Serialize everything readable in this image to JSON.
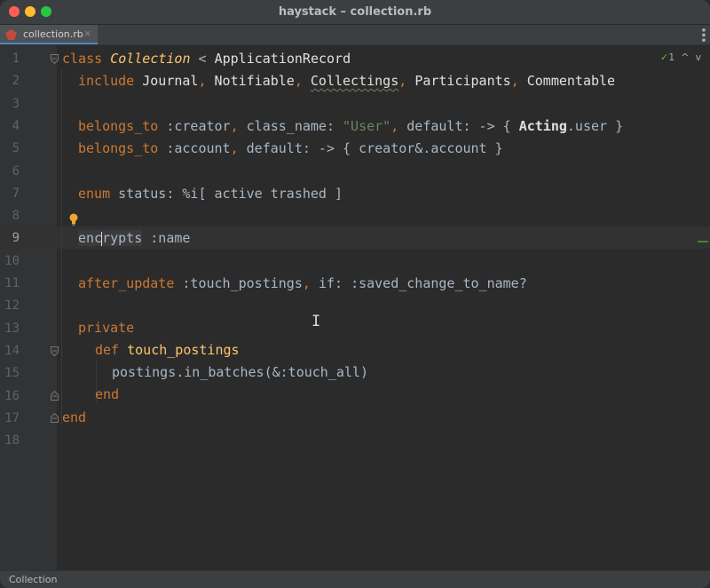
{
  "window": {
    "title": "haystack – collection.rb"
  },
  "tab": {
    "label": "collection.rb",
    "close_glyph": "×"
  },
  "inspections": {
    "count": "1",
    "up": "^",
    "down": "v"
  },
  "status": {
    "breadcrumb": "Collection"
  },
  "gutter": {
    "line_numbers": [
      "1",
      "2",
      "3",
      "4",
      "5",
      "6",
      "7",
      "8",
      "9",
      "10",
      "11",
      "12",
      "13",
      "14",
      "15",
      "16",
      "17",
      "18"
    ],
    "current_line": "9"
  },
  "code": {
    "l1": [
      "class ",
      "Collection",
      " < ",
      "ApplicationRecord"
    ],
    "l2": [
      "include ",
      "Journal",
      ", ",
      "Notifiable",
      ", ",
      "Collectings",
      ", ",
      "Participants",
      ", ",
      "Commentable"
    ],
    "l4": [
      "belongs_to ",
      ":creator",
      ", ",
      "class_name:",
      " ",
      "\"User\"",
      ", ",
      "default:",
      " -> { ",
      "Acting",
      ".user }"
    ],
    "l5": [
      "belongs_to ",
      ":account",
      ", ",
      "default:",
      " -> { creator&.account }"
    ],
    "l7": [
      "enum ",
      "status:",
      " ",
      "%i[ active trashed ]"
    ],
    "l9": [
      "enc",
      "rypts",
      " ",
      ":name"
    ],
    "l11": [
      "after_update ",
      ":touch_postings",
      ", ",
      "if:",
      " ",
      ":saved_change_to_name?"
    ],
    "l13": [
      "private"
    ],
    "l14": [
      "def ",
      "touch_postings"
    ],
    "l15": [
      "postings.in_batches(&",
      ":touch_all",
      ")"
    ],
    "l16": [
      "end"
    ],
    "l17": [
      "end"
    ]
  },
  "icons": {
    "bulb": "lightbulb-icon",
    "file": "ruby-file-icon",
    "check": "check-icon",
    "menu": "more-vertical-icon"
  },
  "colors": {
    "keyword": "#cc7832",
    "class_name": "#ffc66d",
    "string": "#6a8759",
    "text": "#a9b7c6",
    "background": "#2b2b2b"
  }
}
